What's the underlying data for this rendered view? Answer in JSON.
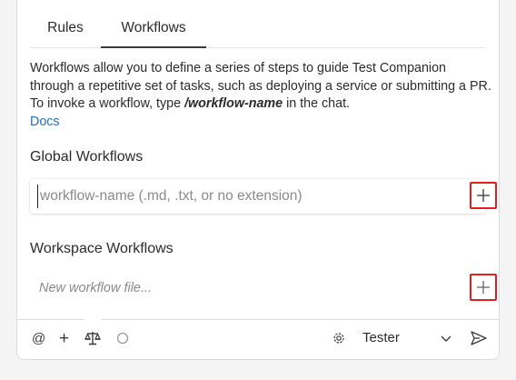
{
  "tabs": {
    "rules": "Rules",
    "workflows": "Workflows"
  },
  "description": {
    "text_before": "Workflows allow you to define a series of steps to guide Test Companion through a repetitive set of tasks, such as deploying a service or submitting a PR. To invoke a workflow, type ",
    "command": "/workflow-name",
    "text_after": " in the chat.",
    "docs_link": "Docs"
  },
  "global_workflows": {
    "title": "Global Workflows",
    "placeholder": "workflow-name (.md, .txt, or no extension)"
  },
  "workspace_workflows": {
    "title": "Workspace Workflows",
    "placeholder": "New workflow file..."
  },
  "composer": {
    "mention_symbol": "@",
    "add_symbol": "+",
    "model_name": "Tester"
  },
  "colors": {
    "link": "#1f6fb8",
    "highlight_box": "#e02020"
  }
}
